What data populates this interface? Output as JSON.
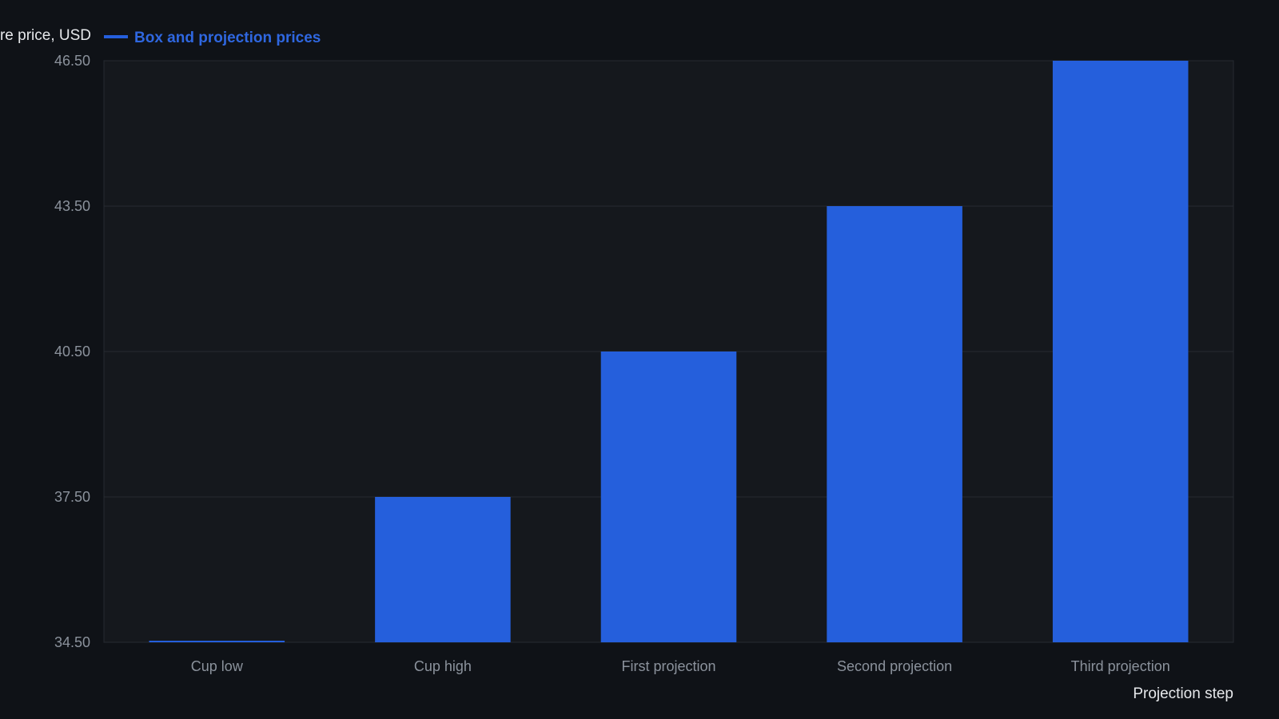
{
  "chart_data": {
    "type": "bar",
    "categories": [
      "Cup low",
      "Cup high",
      "First projection",
      "Second projection",
      "Third projection"
    ],
    "series": [
      {
        "name": "Box and projection prices",
        "values": [
          34.5,
          37.5,
          40.5,
          43.5,
          46.5
        ]
      }
    ],
    "ylabel": "re price, USD",
    "xlabel": "Projection step",
    "ylim": [
      34.5,
      46.5
    ],
    "yticks": [
      "34.50",
      "37.50",
      "40.50",
      "43.50",
      "46.50"
    ],
    "grid": true,
    "legend_position": "top-left",
    "colors": {
      "background": "#0f1217",
      "plot_background": "#15181d",
      "bar": "#255fdc",
      "grid": "#262a31",
      "legend_text": "#2f67e0"
    }
  }
}
